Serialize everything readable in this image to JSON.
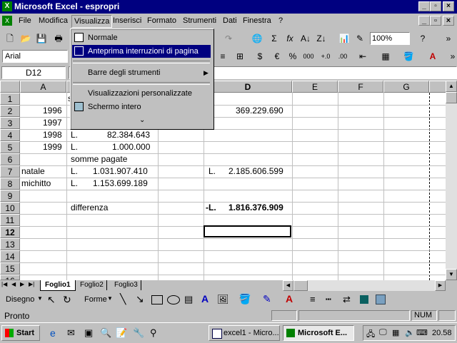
{
  "title": {
    "text": "Microsoft Excel - espropri"
  },
  "menubar": {
    "items": [
      "File",
      "Modifica",
      "Visualizza",
      "Inserisci",
      "Formato",
      "Strumenti",
      "Dati",
      "Finestra",
      "?"
    ]
  },
  "toolbar": {
    "zoom": "100%",
    "font": "Arial"
  },
  "namebox": {
    "value": "D12"
  },
  "view_menu": {
    "items": [
      {
        "label": "Normale"
      },
      {
        "label": "Anteprima interruzioni di pagina"
      },
      {
        "label": "Barre degli strumenti"
      },
      {
        "label": "Visualizzazioni personalizzate"
      },
      {
        "label": "Schermo intero"
      }
    ]
  },
  "columns": [
    "A",
    "B",
    "C",
    "D",
    "E",
    "F",
    "G"
  ],
  "rows": [
    "1",
    "2",
    "3",
    "4",
    "5",
    "6",
    "7",
    "8",
    "9",
    "10",
    "11",
    "12",
    "13",
    "14",
    "15",
    "16"
  ],
  "cells": {
    "a2": "1996",
    "a3": "1997",
    "a4": "1998",
    "a5": "1999",
    "b4_l": "L.",
    "b4_v": "82.384.643",
    "b5_l": "L.",
    "b5_v": "1.000.000",
    "b6": "somme pagate",
    "a7": "natale",
    "b7_l": "L.",
    "b7_v": "1.031.907.410",
    "d7_l": "L.",
    "d7_v": "2.185.606.599",
    "a8": "michitto",
    "b8_l": "L.",
    "b8_v": "1.153.699.189",
    "b10": "differenza",
    "d10_l": "-L.",
    "d10_v": "1.816.376.909",
    "d2_v": "369.229.690",
    "b1_frag": "s",
    "b2_frag": "L",
    "b3_frag": "L"
  },
  "sheets": [
    "Foglio1",
    "Foglio2",
    "Foglio3"
  ],
  "drawing": {
    "draw": "Disegno",
    "shapes": "Forme"
  },
  "status": {
    "text": "Pronto",
    "num": "NUM"
  },
  "taskbar": {
    "start": "Start",
    "task1": "excel1 - Micro...",
    "task2": "Microsoft E...",
    "clock": "20.58"
  }
}
